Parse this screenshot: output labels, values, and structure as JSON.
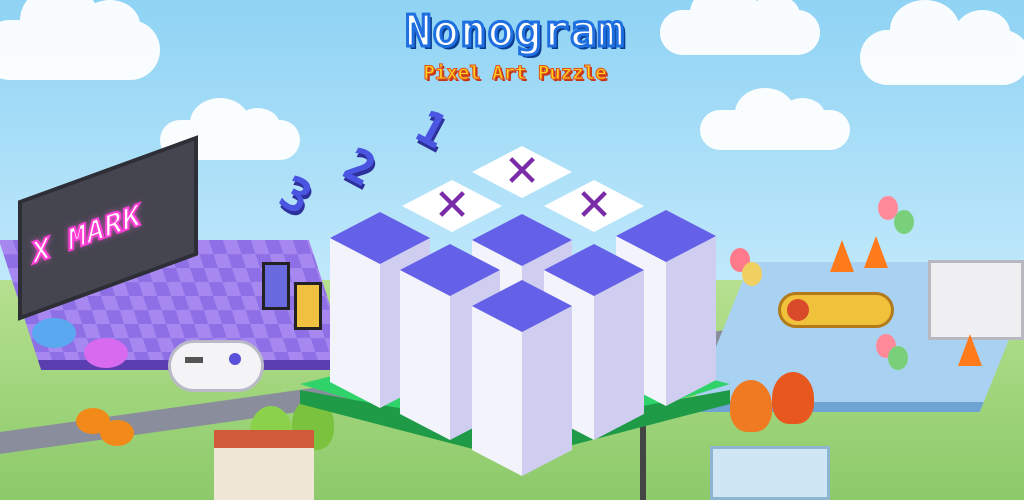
{
  "header": {
    "title": "Nonogram",
    "subtitle": "Pixel Art Puzzle"
  },
  "billboard": {
    "text": "X MARK"
  },
  "puzzle": {
    "clues": [
      "3",
      "2",
      "1"
    ],
    "marked_cells": 3,
    "filled_pillars": 6,
    "mark_symbol": "✕"
  },
  "colors": {
    "title_text": "#ffffff",
    "title_outline": "#1f6fe0",
    "subtitle_text": "#ffd21f",
    "pillar_top": "#6560e8",
    "mark": "#7a2ca8",
    "base": "#2fd36a"
  },
  "icons": [
    "x-mark-icon",
    "game-controller-icon",
    "balloon-icon",
    "traffic-cone-icon",
    "airplane-icon"
  ]
}
